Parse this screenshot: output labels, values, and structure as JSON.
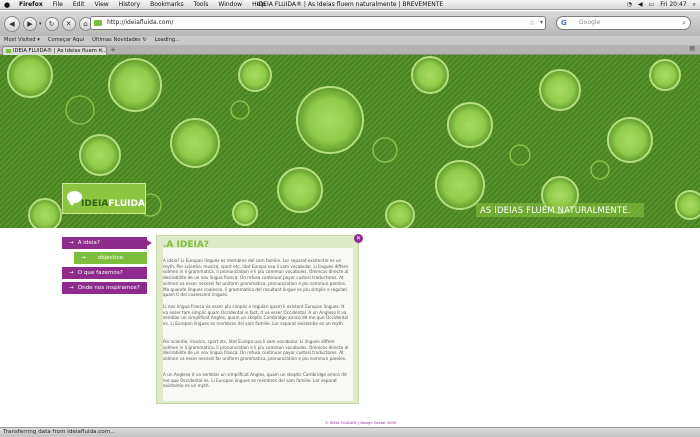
{
  "menubar": {
    "apple": "",
    "items": [
      "Firefox",
      "File",
      "Edit",
      "View",
      "History",
      "Bookmarks",
      "Tools",
      "Window",
      "Help"
    ],
    "window_title": "IDEIA FLUIDA® | As Ideias fluem naturalmente | BREVEMENTE",
    "clock": "Fri 20:47"
  },
  "toolbar": {
    "url": "http://ideiafluida.com/",
    "search_placeholder": "Google"
  },
  "bookmarks": [
    "Most Visited ▾",
    "Começar Aqui",
    "Últimas Novidades ↻",
    "Loading..."
  ],
  "tab": {
    "title": "IDEIA FLUIDA® | As Ideias fluem n..."
  },
  "hero": {
    "logo_part1": "IDEIA",
    "logo_part2": "FLUIDA",
    "tagline": "AS IDEIAS FLUEM NATURALMENTE."
  },
  "nav": {
    "items": [
      {
        "label": "A ideia?"
      },
      {
        "label": "objectivo"
      },
      {
        "label": "O que fazemos?"
      },
      {
        "label": "Onde nos inspiramos?"
      }
    ]
  },
  "content": {
    "title": ".A IDEIA?",
    "close": "✕",
    "paragraphs": [
      "A ideia? Li Europan lingues es membres del sam familie. Lor separat existentie es un myth. Por scientie, musica, sport etc, litot Europa usa li sam vocabular. Li lingues differe solmen in li grammatica, li pronunciation e li plu commun vocabules. Omnicos directe al desirabilite de un nov lingua franca: On refusa continuar payar custosi traductores. At solmen va esser necessi far uniform grammatica, pronunciation e plu sommun paroles. Ma quande lingues coalesce, li grammatica del resultant lingue es plu simplic e regulari quam ti del coalescent lingues.",
      "Li nov lingua franca va esser plu simplic e regulari quam li existent Europan lingues. It va esser tam simplic quam Occidental in fact, it va esser Occidental. A un Angleso it va semblar un simplificat Angles, quam un skeptic Cambridge amico dit me que Occidental es. Li Europan lingues es membres del sam familie. Lor separat existentie es un myth.",
      "Por scientie, musica, sport etc, litot Europa usa li sam vocabular. Li lingues differe solmen in li grammatica, li pronunciation e li plu commun vocabules. Omnicos directe al desirabilite de un nov lingua franca: On refusa continuar payar custosi traductores. At solmen va esser necessi far uniform grammatica, pronunciation e plu sommun paroles.",
      "A un Angleso it va semblar un simplificat Angles, quam un skeptic Cambridge amico dit me que Occidental es. Li Europan lingues es membres del sam familie. Lor separat existentie es un myth."
    ],
    "footer": "© IDEIA FLUIDA® | Design Gestat 2009"
  },
  "status": {
    "text": "Transferring data from ideiafluida.com..."
  }
}
